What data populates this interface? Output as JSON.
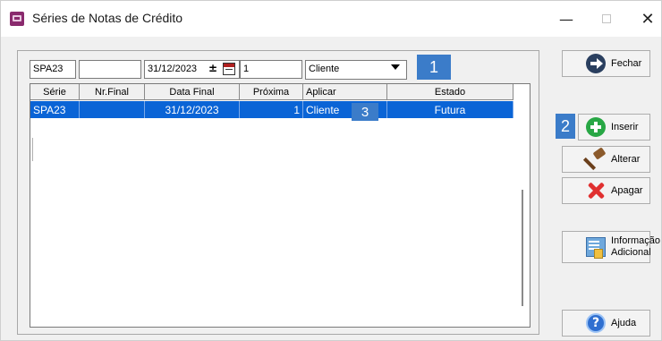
{
  "window": {
    "title": "Séries de Notas de Crédito",
    "minimize": "—",
    "close": "✕"
  },
  "filters": {
    "serie": "SPA23",
    "nr_final": "",
    "data_final": "31/12/2023",
    "proxima": "1",
    "aplicar": "Cliente",
    "spin_symbol": "±"
  },
  "grid": {
    "columns": [
      "Série",
      "Nr.Final",
      "Data Final",
      "Próxima",
      "Aplicar",
      "Estado"
    ],
    "rows": [
      {
        "serie": "SPA23",
        "nr_final": "",
        "data_final": "31/12/2023",
        "proxima": "1",
        "aplicar": "Cliente",
        "estado": "Futura"
      }
    ]
  },
  "badges": {
    "b1": "1",
    "b2": "2",
    "b3": "3"
  },
  "buttons": {
    "fechar": "Fechar",
    "inserir": "Inserir",
    "alterar": "Alterar",
    "apagar": "Apagar",
    "info_line1": "Informação",
    "info_line2": "Adicional",
    "ajuda": "Ajuda",
    "ajuda_icon_glyph": "?"
  },
  "icons": {
    "app": "app-icon",
    "fechar": "arrow-right-circle-icon",
    "inserir": "plus-circle-icon",
    "alterar": "hammer-icon",
    "apagar": "red-x-icon",
    "info": "document-info-icon",
    "ajuda": "help-circle-icon",
    "calendar": "calendar-icon",
    "dropdown": "chevron-down-icon"
  },
  "colors": {
    "selection": "#0a64d6",
    "badge": "#3b7cc9",
    "inserir_green": "#28a745",
    "apagar_red": "#e03030"
  }
}
